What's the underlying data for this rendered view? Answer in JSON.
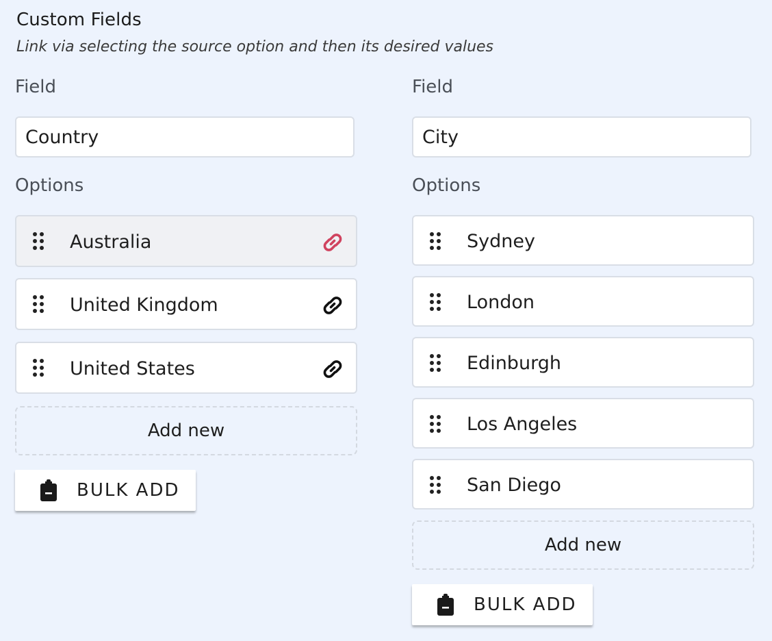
{
  "section": {
    "title": "Custom Fields",
    "subtitle": "Link via selecting the source option and then its desired values"
  },
  "left": {
    "field_label": "Field",
    "field_value": "Country",
    "options_label": "Options",
    "options": [
      {
        "label": "Australia",
        "selected": true,
        "link_color": "#d0435f"
      },
      {
        "label": "United Kingdom",
        "selected": false,
        "link_color": "#111111"
      },
      {
        "label": "United States",
        "selected": false,
        "link_color": "#111111"
      }
    ],
    "add_new_label": "Add new",
    "bulk_add_label": "BULK ADD"
  },
  "right": {
    "field_label": "Field",
    "field_value": "City",
    "options_label": "Options",
    "options": [
      {
        "label": "Sydney"
      },
      {
        "label": "London"
      },
      {
        "label": "Edinburgh"
      },
      {
        "label": "Los Angeles"
      },
      {
        "label": "San Diego"
      }
    ],
    "add_new_label": "Add new",
    "bulk_add_label": "BULK ADD"
  },
  "icons": {
    "drag": "drag-handle-icon",
    "link": "link-icon",
    "clipboard": "clipboard-icon"
  },
  "colors": {
    "background": "#edf3fd",
    "linked_active": "#d0435f",
    "link_default": "#111111"
  }
}
